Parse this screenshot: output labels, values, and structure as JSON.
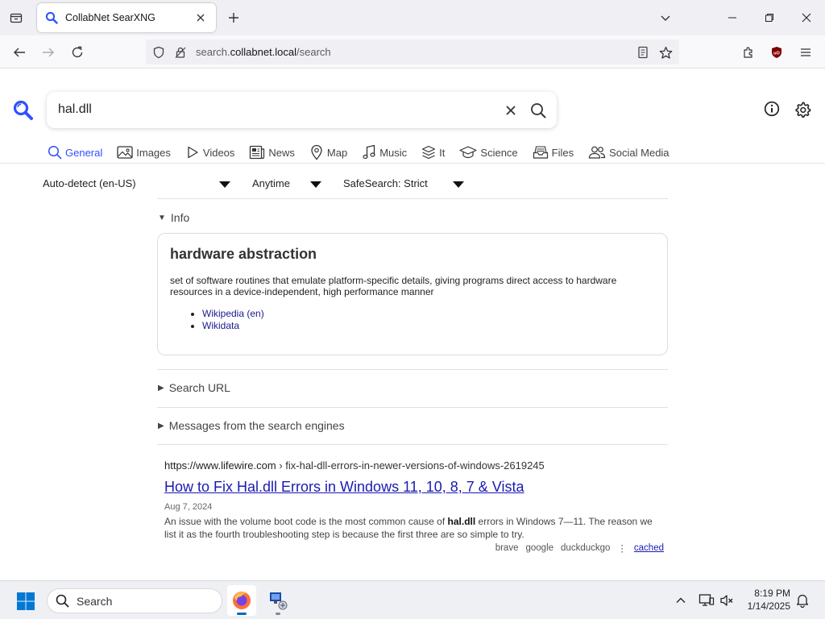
{
  "browser": {
    "tab_title": "CollabNet SearXNG",
    "url_prefix": "search.",
    "url_domain": "collabnet.local",
    "url_path": "/search"
  },
  "search": {
    "query": "hal.dll"
  },
  "categories": [
    {
      "label": "General",
      "icon": "search-icon",
      "active": true
    },
    {
      "label": "Images",
      "icon": "image-icon"
    },
    {
      "label": "Videos",
      "icon": "play-icon"
    },
    {
      "label": "News",
      "icon": "newspaper-icon"
    },
    {
      "label": "Map",
      "icon": "map-pin-icon"
    },
    {
      "label": "Music",
      "icon": "music-icon"
    },
    {
      "label": "It",
      "icon": "layers-icon"
    },
    {
      "label": "Science",
      "icon": "school-icon"
    },
    {
      "label": "Files",
      "icon": "file-tray-icon"
    },
    {
      "label": "Social Media",
      "icon": "people-icon"
    }
  ],
  "filters": {
    "language": "Auto-detect (en-US)",
    "time_range": "Anytime",
    "safesearch": "SafeSearch: Strict"
  },
  "info": {
    "summary": "Info",
    "title": "hardware abstraction",
    "description": "set of software routines that emulate platform-specific details, giving programs direct access to hardware resources in a device-independent, high performance manner",
    "links": [
      "Wikipedia (en)",
      "Wikidata"
    ]
  },
  "sections": {
    "search_url": "Search URL",
    "messages": "Messages from the search engines"
  },
  "result": {
    "url_host": "https://www.lifewire.com",
    "url_path": "› fix-hal-dll-errors-in-newer-versions-of-windows-2619245",
    "title": "How to Fix Hal.dll Errors in Windows 11, 10, 8, 7 & Vista",
    "date": "Aug 7, 2024",
    "content_pre": "An issue with the volume boot code is the most common cause of ",
    "content_bold": "hal.dll",
    "content_post": " errors in Windows 7—11. The reason we list it as the fourth troubleshooting step is because the first three are so simple to try.",
    "engines": [
      "brave",
      "google",
      "duckduckgo"
    ],
    "cached": "cached"
  },
  "taskbar": {
    "search_placeholder": "Search",
    "time": "8:19 PM",
    "date": "1/14/2025"
  },
  "colors": {
    "accent": "#3050ff",
    "link": "#1a1ab4",
    "taskbar_indicator": "#0067c0"
  }
}
